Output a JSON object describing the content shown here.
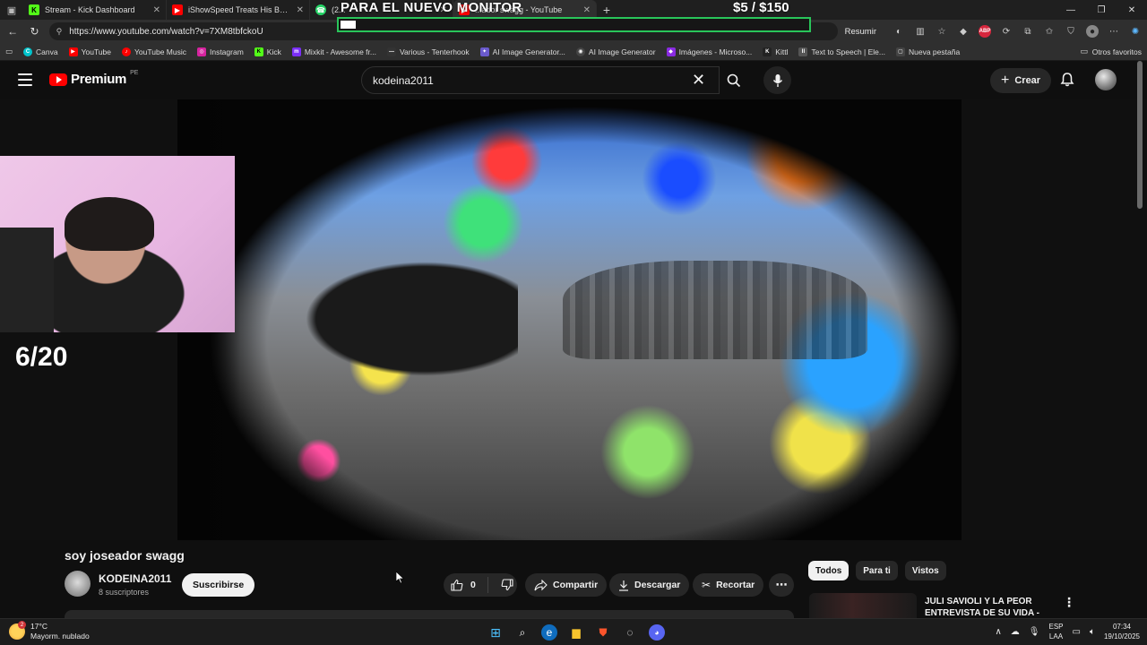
{
  "browser": {
    "tabs": [
      {
        "title": "Stream - Kick Dashboard",
        "favicon": "kick-icon",
        "color": "#53fc18",
        "glyph": "K",
        "active": false
      },
      {
        "title": "iShowSpeed Treats His Bodyguar...",
        "favicon": "youtube-icon",
        "color": "#ff0000",
        "glyph": "▶",
        "active": false
      },
      {
        "title": "(2...",
        "favicon": "whatsapp-icon",
        "color": "#25d366",
        "glyph": "☎",
        "active": false
      },
      {
        "title": "...ador swagg - YouTube",
        "favicon": "youtube-icon",
        "color": "#ff0000",
        "glyph": "▶",
        "active": true
      }
    ],
    "new_tab": "+",
    "url": "https://www.youtube.com/watch?v=7XM8tbfckoU",
    "resumir": "Resumir",
    "bookmarks": [
      {
        "label": "Canva",
        "color": "#00c4cc",
        "glyph": "C"
      },
      {
        "label": "YouTube",
        "color": "#ff0000",
        "glyph": "▶"
      },
      {
        "label": "YouTube Music",
        "color": "#ff0000",
        "glyph": "♪"
      },
      {
        "label": "Instagram",
        "color": "#d6249f",
        "glyph": "◎"
      },
      {
        "label": "Kick",
        "color": "#53fc18",
        "glyph": "K"
      },
      {
        "label": "Mixkit - Awesome fr...",
        "color": "#7b2ff7",
        "glyph": "m"
      },
      {
        "label": "Various - Tenterhook",
        "color": "#333333",
        "glyph": "—"
      },
      {
        "label": "AI Image Generator...",
        "color": "#6a5acd",
        "glyph": "✦"
      },
      {
        "label": "AI Image Generator",
        "color": "#444444",
        "glyph": "◉"
      },
      {
        "label": "Imágenes - Microso...",
        "color": "#8a2be2",
        "glyph": "◆"
      },
      {
        "label": "Kittl",
        "color": "#222222",
        "glyph": "K"
      },
      {
        "label": "Text to Speech | Ele...",
        "color": "#555555",
        "glyph": "II"
      },
      {
        "label": "Nueva pestaña",
        "color": "#444444",
        "glyph": "▢"
      }
    ],
    "other_favorites": "Otros favoritos"
  },
  "overlay": {
    "title": "PARA EL NUEVO MONITOR",
    "goal": "$5  / $150",
    "progress": 0.033,
    "counter": "6/20"
  },
  "youtube": {
    "logo_text": "Premium",
    "region": "PE",
    "search_value": "kodeina2011",
    "create_label": "Crear",
    "video": {
      "title": "soy joseador swagg",
      "channel": "KODEINA2011",
      "subscribers": "8 suscriptores",
      "subscribe_label": "Suscribirse",
      "likes": "0",
      "share_label": "Compartir",
      "download_label": "Descargar",
      "clip_label": "Recortar"
    },
    "chips": [
      "Todos",
      "Para ti",
      "Vistos"
    ],
    "recommended": {
      "title": "JULI SAVIOLI Y LA PEOR ENTREVISTA DE SU VIDA -"
    }
  },
  "taskbar": {
    "weather_temp": "17°C",
    "weather_desc": "Mayorm. nublado",
    "weather_badge": "2",
    "lang_top": "ESP",
    "lang_bottom": "LAA",
    "time": "07:34",
    "date": "19/10/2025"
  }
}
